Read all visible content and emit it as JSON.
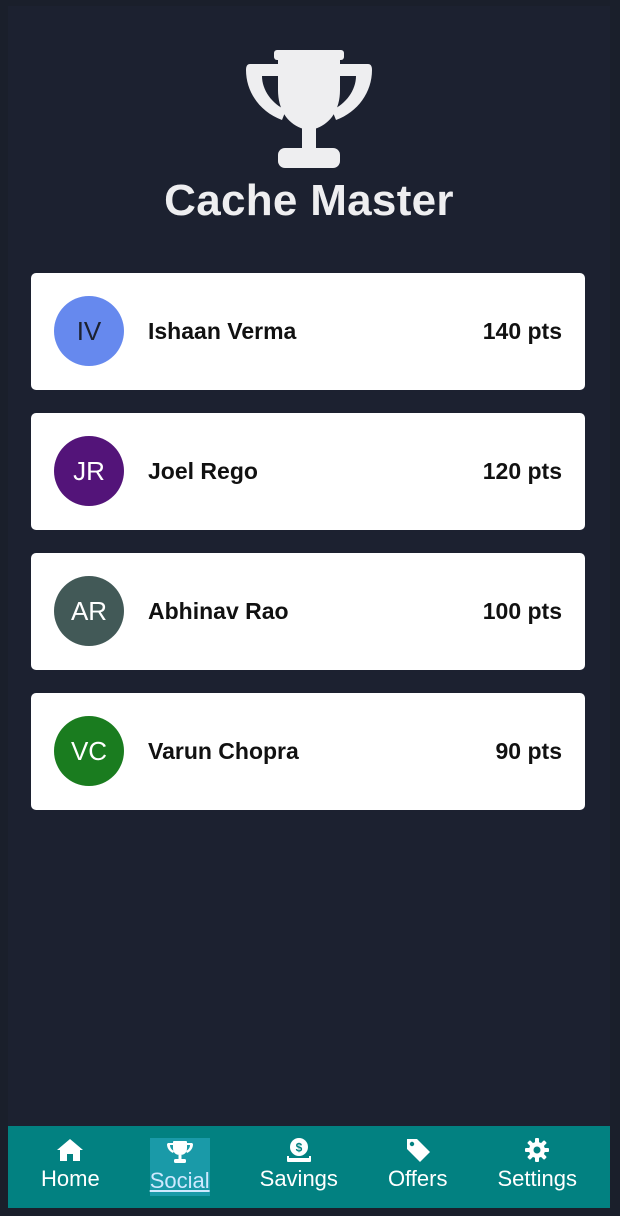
{
  "header": {
    "title": "Cache Master",
    "icon": "trophy-icon",
    "icon_color": "#eeeef0"
  },
  "leaderboard": [
    {
      "initials": "IV",
      "name": "Ishaan Verma",
      "points": "140 pts",
      "avatar_color": "#6689ee",
      "initials_color": "#1c2130"
    },
    {
      "initials": "JR",
      "name": "Joel Rego",
      "points": "120 pts",
      "avatar_color": "#531479",
      "initials_color": "#ffffff"
    },
    {
      "initials": "AR",
      "name": "Abhinav Rao",
      "points": "100 pts",
      "avatar_color": "#425957",
      "initials_color": "#ffffff"
    },
    {
      "initials": "VC",
      "name": "Varun Chopra",
      "points": "90 pts",
      "avatar_color": "#1a7c1f",
      "initials_color": "#ffffff"
    }
  ],
  "tabbar": {
    "tabs": [
      {
        "label": "Home",
        "icon": "home-icon",
        "active": false
      },
      {
        "label": "Social",
        "icon": "trophy-icon",
        "active": true
      },
      {
        "label": "Savings",
        "icon": "money-bag-icon",
        "active": false
      },
      {
        "label": "Offers",
        "icon": "tag-icon",
        "active": false
      },
      {
        "label": "Settings",
        "icon": "gear-icon",
        "active": false
      }
    ],
    "background": "#028181",
    "active_background": "#1a9aa8"
  },
  "colors": {
    "background": "#1c2130",
    "card": "#ffffff"
  }
}
